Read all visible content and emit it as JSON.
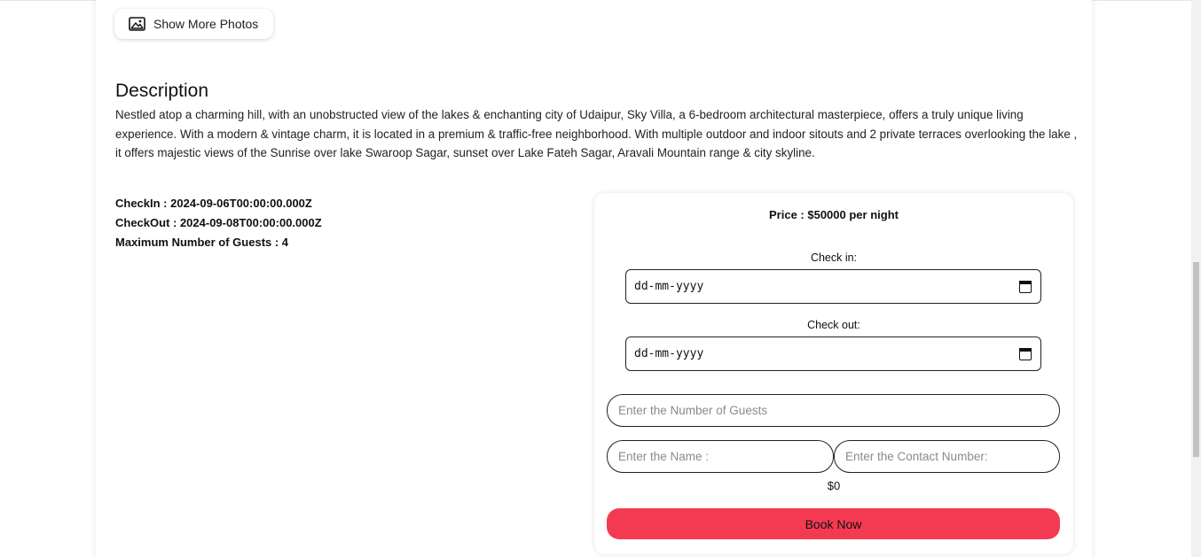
{
  "photos_button": {
    "label": "Show More Photos",
    "icon": "image-icon"
  },
  "description": {
    "title": "Description",
    "text": "Nestled atop a charming hill, with an unobstructed view of the lakes & enchanting city of Udaipur, Sky Villa, a 6-bedroom architectural masterpiece, offers a truly unique living experience. With a modern & vintage charm, it is located in a premium & traffic-free neighborhood. With multiple outdoor and indoor sitouts and 2 private terraces overlooking the lake , it offers majestic views of the Sunrise over lake Swaroop Sagar, sunset over Lake Fateh Sagar, Aravali Mountain range & city skyline."
  },
  "details": {
    "checkin": "CheckIn : 2024-09-06T00:00:00.000Z",
    "checkout": "CheckOut : 2024-09-08T00:00:00.000Z",
    "max_guests": "Maximum Number of Guests : 4"
  },
  "booking": {
    "price": "Price : $50000 per night",
    "checkin_label": "Check in:",
    "checkin_value": "dd-mm-yyyy",
    "checkout_label": "Check out:",
    "checkout_value": "dd-mm-yyyy",
    "guests_placeholder": "Enter the Number of Guests",
    "name_placeholder": "Enter the Name :",
    "contact_placeholder": "Enter the Contact Number:",
    "total": "$0",
    "book_label": "Book Now",
    "accent_color": "#f43a52"
  }
}
